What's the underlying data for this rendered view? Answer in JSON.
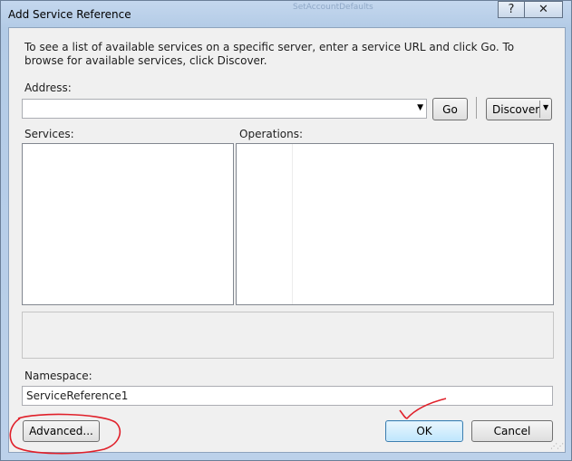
{
  "window": {
    "title": "Add Service Reference",
    "ghost_caption": "SetAccountDefaults",
    "help_glyph": "?",
    "close_glyph": "✕"
  },
  "instructions": "To see a list of available services on a specific server, enter a service URL and click Go. To browse for available services, click Discover.",
  "address": {
    "label": "Address:",
    "value": ""
  },
  "buttons": {
    "go": "Go",
    "discover": "Discover",
    "advanced": "Advanced...",
    "ok": "OK",
    "cancel": "Cancel"
  },
  "services": {
    "label": "Services:"
  },
  "operations": {
    "label": "Operations:"
  },
  "namespace": {
    "label": "Namespace:",
    "value": "ServiceReference1"
  },
  "colors": {
    "annotation": "#e0202a"
  }
}
